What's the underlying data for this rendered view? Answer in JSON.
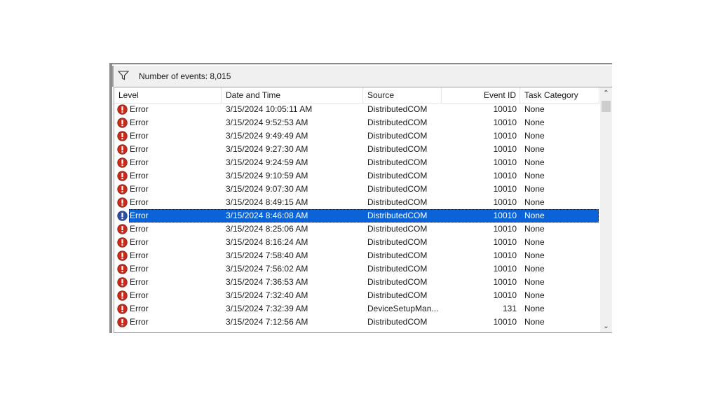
{
  "filter_bar": {
    "text": "Number of events: 8,015"
  },
  "columns": [
    {
      "key": "level",
      "label": "Level"
    },
    {
      "key": "datetime",
      "label": "Date and Time"
    },
    {
      "key": "source",
      "label": "Source"
    },
    {
      "key": "event_id",
      "label": "Event ID"
    },
    {
      "key": "task_category",
      "label": "Task Category"
    }
  ],
  "events": [
    {
      "level": "Error",
      "datetime": "3/15/2024 10:05:11 AM",
      "source": "DistributedCOM",
      "event_id": "10010",
      "task_category": "None",
      "selected": false
    },
    {
      "level": "Error",
      "datetime": "3/15/2024 9:52:53 AM",
      "source": "DistributedCOM",
      "event_id": "10010",
      "task_category": "None",
      "selected": false
    },
    {
      "level": "Error",
      "datetime": "3/15/2024 9:49:49 AM",
      "source": "DistributedCOM",
      "event_id": "10010",
      "task_category": "None",
      "selected": false
    },
    {
      "level": "Error",
      "datetime": "3/15/2024 9:27:30 AM",
      "source": "DistributedCOM",
      "event_id": "10010",
      "task_category": "None",
      "selected": false
    },
    {
      "level": "Error",
      "datetime": "3/15/2024 9:24:59 AM",
      "source": "DistributedCOM",
      "event_id": "10010",
      "task_category": "None",
      "selected": false
    },
    {
      "level": "Error",
      "datetime": "3/15/2024 9:10:59 AM",
      "source": "DistributedCOM",
      "event_id": "10010",
      "task_category": "None",
      "selected": false
    },
    {
      "level": "Error",
      "datetime": "3/15/2024 9:07:30 AM",
      "source": "DistributedCOM",
      "event_id": "10010",
      "task_category": "None",
      "selected": false
    },
    {
      "level": "Error",
      "datetime": "3/15/2024 8:49:15 AM",
      "source": "DistributedCOM",
      "event_id": "10010",
      "task_category": "None",
      "selected": false
    },
    {
      "level": "Error",
      "datetime": "3/15/2024 8:46:08 AM",
      "source": "DistributedCOM",
      "event_id": "10010",
      "task_category": "None",
      "selected": true
    },
    {
      "level": "Error",
      "datetime": "3/15/2024 8:25:06 AM",
      "source": "DistributedCOM",
      "event_id": "10010",
      "task_category": "None",
      "selected": false
    },
    {
      "level": "Error",
      "datetime": "3/15/2024 8:16:24 AM",
      "source": "DistributedCOM",
      "event_id": "10010",
      "task_category": "None",
      "selected": false
    },
    {
      "level": "Error",
      "datetime": "3/15/2024 7:58:40 AM",
      "source": "DistributedCOM",
      "event_id": "10010",
      "task_category": "None",
      "selected": false
    },
    {
      "level": "Error",
      "datetime": "3/15/2024 7:56:02 AM",
      "source": "DistributedCOM",
      "event_id": "10010",
      "task_category": "None",
      "selected": false
    },
    {
      "level": "Error",
      "datetime": "3/15/2024 7:36:53 AM",
      "source": "DistributedCOM",
      "event_id": "10010",
      "task_category": "None",
      "selected": false
    },
    {
      "level": "Error",
      "datetime": "3/15/2024 7:32:40 AM",
      "source": "DistributedCOM",
      "event_id": "10010",
      "task_category": "None",
      "selected": false
    },
    {
      "level": "Error",
      "datetime": "3/15/2024 7:32:39 AM",
      "source": "DeviceSetupMan...",
      "event_id": "131",
      "task_category": "None",
      "selected": false
    },
    {
      "level": "Error",
      "datetime": "3/15/2024 7:12:56 AM",
      "source": "DistributedCOM",
      "event_id": "10010",
      "task_category": "None",
      "selected": false
    }
  ],
  "icons": {
    "filter": "filter-funnel-icon",
    "level": "error-icon",
    "scroll_up": "chevron-up-icon",
    "scroll_down": "chevron-down-icon"
  },
  "colors": {
    "error_red": "#c42b1c",
    "selection_blue": "#0a64d8",
    "selected_icon_blue": "#2f4f9e"
  }
}
